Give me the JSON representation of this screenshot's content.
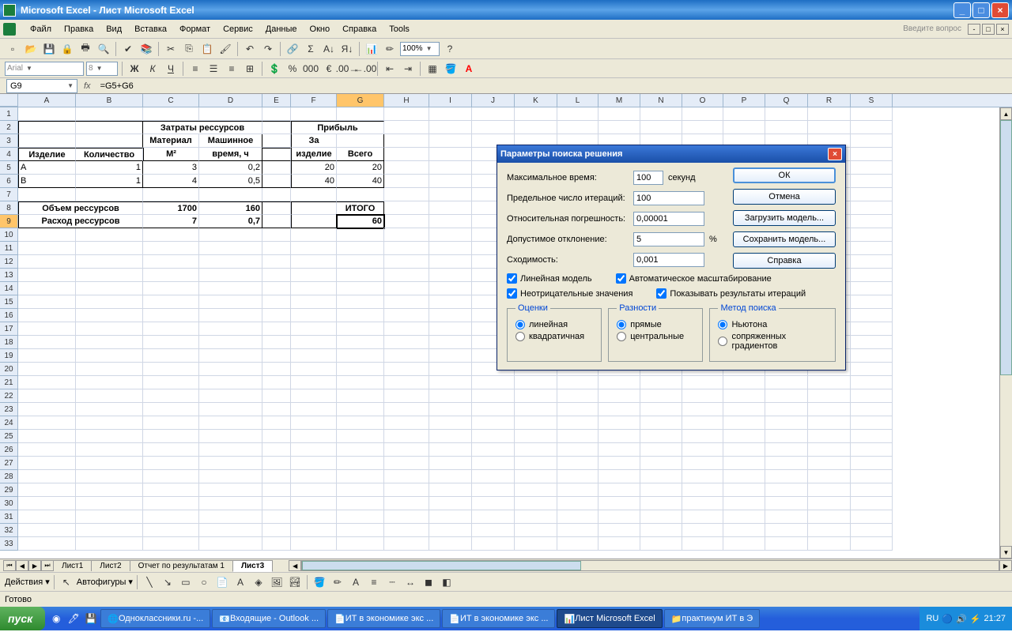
{
  "titlebar": {
    "app": "Microsoft Excel",
    "doc": "Лист Microsoft Excel"
  },
  "menu": {
    "file": "Файл",
    "edit": "Правка",
    "view": "Вид",
    "insert": "Вставка",
    "format": "Формат",
    "tools_ru": "Сервис",
    "data": "Данные",
    "window": "Окно",
    "help": "Справка",
    "tools_en": "Tools",
    "ask": "Введите вопрос"
  },
  "formatting": {
    "font": "Arial",
    "size": "8",
    "zoom": "100%"
  },
  "formula": {
    "cell": "G9",
    "fx": "fx",
    "value": "=G5+G6"
  },
  "columns": [
    "A",
    "B",
    "C",
    "D",
    "E",
    "F",
    "G",
    "H",
    "I",
    "J",
    "K",
    "L",
    "M",
    "N",
    "O",
    "P",
    "Q",
    "R",
    "S"
  ],
  "table": {
    "h_resources": "Затраты рессурсов",
    "h_profit": "Прибыль",
    "h_product": "Изделие",
    "h_qty": "Количество",
    "h_material": "Материал М²",
    "h_machine": "Машинное время, ч",
    "h_perunit": "За изделие",
    "h_total": "Всего",
    "rowA": {
      "name": "А",
      "qty": "1",
      "mat": "3",
      "time": "0,2",
      "per": "20",
      "tot": "20"
    },
    "rowB": {
      "name": "В",
      "qty": "1",
      "mat": "4",
      "time": "0,5",
      "per": "40",
      "tot": "40"
    },
    "volume": {
      "label": "Объем рессурсов",
      "mat": "1700",
      "time": "160",
      "itogo": "ИТОГО"
    },
    "spend": {
      "label": "Расход рессурсов",
      "mat": "7",
      "time": "0,7",
      "total": "60"
    }
  },
  "sheets": {
    "s1": "Лист1",
    "s2": "Лист2",
    "s3": "Отчет по результатам 1",
    "s4": "Лист3"
  },
  "draw": {
    "actions": "Действия",
    "autoshapes": "Автофигуры"
  },
  "status": "Готово",
  "dialog": {
    "title": "Параметры поиска решения",
    "maxtime_l": "Максимальное время:",
    "maxtime_v": "100",
    "maxtime_u": "секунд",
    "iter_l": "Предельное число итераций:",
    "iter_v": "100",
    "prec_l": "Относительная погрешность:",
    "prec_v": "0,00001",
    "tol_l": "Допустимое отклонение:",
    "tol_v": "5",
    "tol_u": "%",
    "conv_l": "Сходимость:",
    "conv_v": "0,001",
    "chk_linear": "Линейная модель",
    "chk_auto": "Автоматическое масштабирование",
    "chk_nonneg": "Неотрицательные значения",
    "chk_show": "Показывать результаты итераций",
    "grp_est": "Оценки",
    "est_lin": "линейная",
    "est_quad": "квадратичная",
    "grp_der": "Разности",
    "der_fwd": "прямые",
    "der_cen": "центральные",
    "grp_search": "Метод поиска",
    "s_newton": "Ньютона",
    "s_conj": "сопряженных градиентов",
    "btn_ok": "ОК",
    "btn_cancel": "Отмена",
    "btn_load": "Загрузить модель...",
    "btn_save": "Сохранить модель...",
    "btn_help": "Справка"
  },
  "taskbar": {
    "start": "пуск",
    "t1": "Одноклассники.ru -...",
    "t2": "Входящие - Outlook ...",
    "t3": "ИТ в экономике экс ...",
    "t4": "ИТ в экономике экс ...",
    "t5": "Лист Microsoft Excel",
    "t6": "практикум ИТ в Э",
    "lang": "RU",
    "time": "21:27"
  }
}
